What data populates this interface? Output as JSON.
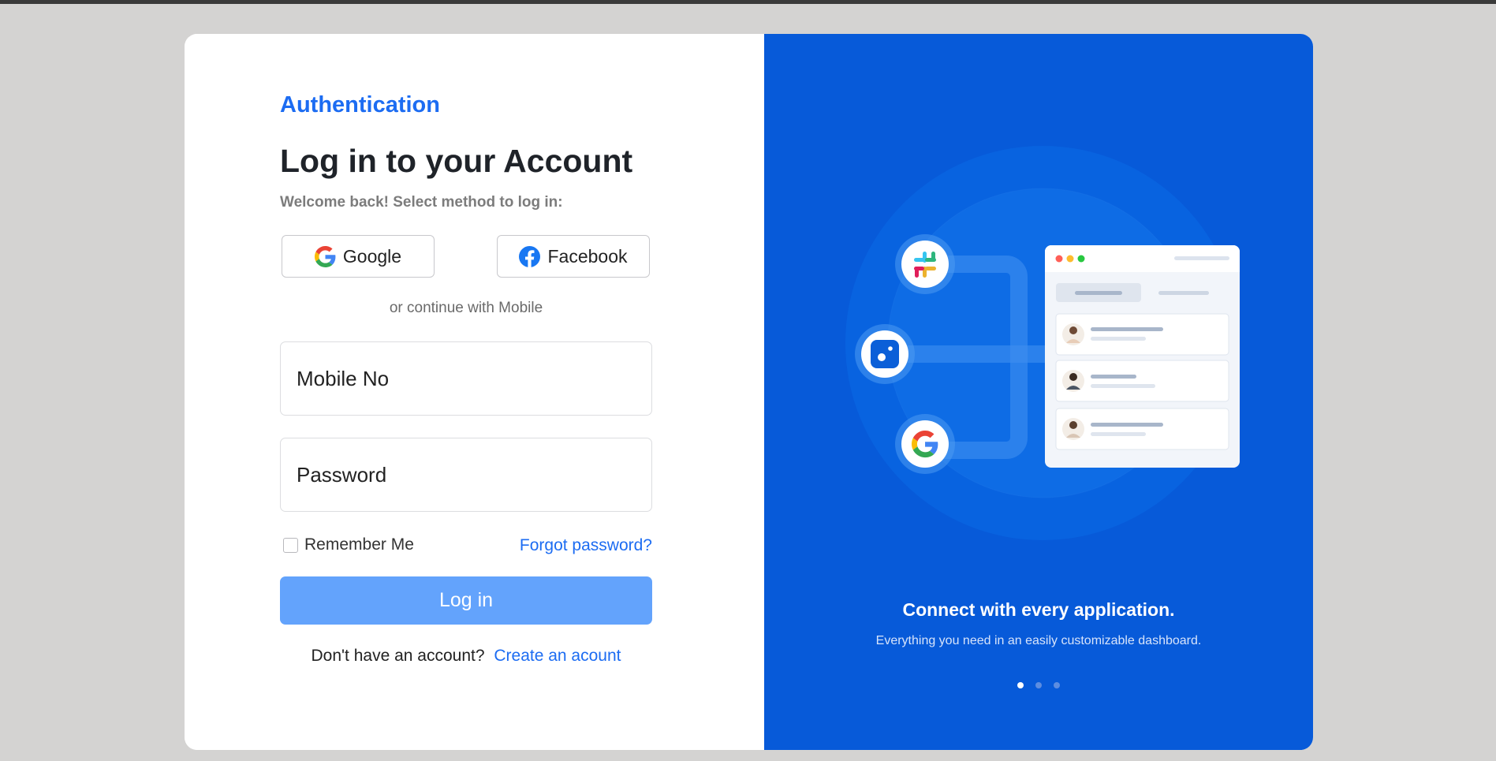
{
  "brand": "Authentication",
  "login": {
    "title": "Log in to your Account",
    "subtitle": "Welcome back! Select method to log in:",
    "google_label": "Google",
    "facebook_label": "Facebook",
    "divider": "or continue with Mobile",
    "mobile_placeholder": "Mobile No",
    "password_placeholder": "Password",
    "remember_label": "Remember Me",
    "forgot_label": "Forgot password?",
    "login_button": "Log in",
    "no_account_text": "Don't have an account?",
    "create_account_label": "Create an acount"
  },
  "promo": {
    "title": "Connect with every application.",
    "subtitle": "Everything you need in an easily customizable dashboard.",
    "carousel_active_index": 0,
    "carousel_total": 3
  },
  "colors": {
    "accent": "#1c6cf2",
    "login_button": "#63a3fc",
    "promo_bg": "#075ad9"
  },
  "icons": [
    "google-icon",
    "facebook-icon",
    "slack-icon",
    "app-icon",
    "window-dot-icons",
    "avatar-icons"
  ]
}
